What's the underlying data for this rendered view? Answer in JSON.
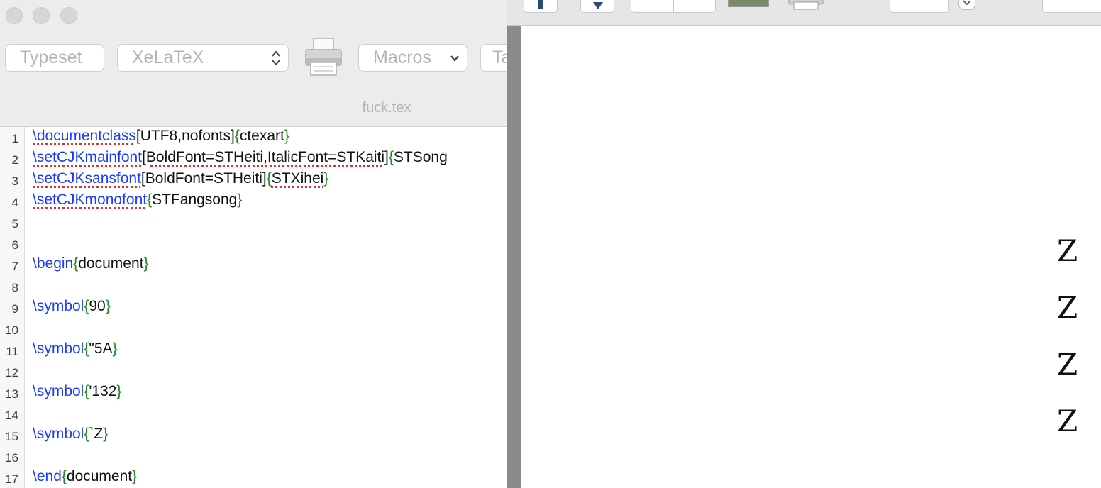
{
  "editor": {
    "toolbar": {
      "typeset_label": "Typeset",
      "engine_value": "XeLaTeX",
      "macros_label": "Macros",
      "tags_label": "Ta"
    },
    "filename": "fuck.tex",
    "line_numbers": [
      "1",
      "2",
      "3",
      "4",
      "5",
      "6",
      "7",
      "8",
      "9",
      "10",
      "11",
      "12",
      "13",
      "14",
      "15",
      "16",
      "17"
    ],
    "code": {
      "l1": {
        "cmd": "\\documentclass",
        "opt": "[UTF8,nofonts]",
        "ob": "{",
        "arg": "ctexart",
        "cb": "}"
      },
      "l2": {
        "cmd": "\\setCJKmainfont",
        "opt": "[BoldFont=STHeiti,ItalicFont=STKaiti]",
        "ob": "{",
        "arg": "STSong"
      },
      "l3": {
        "cmd": "\\setCJKsansfont",
        "opt": "[BoldFont=STHeiti]",
        "ob": "{",
        "arg": "STXihei",
        "cb": "}"
      },
      "l4": {
        "cmd": "\\setCJKmonofont",
        "ob": "{",
        "arg": "STFangsong",
        "cb": "}"
      },
      "l7": {
        "cmd": "\\begin",
        "ob": "{",
        "arg": "document",
        "cb": "}"
      },
      "l9": {
        "cmd": "\\symbol",
        "ob": "{",
        "arg": "90",
        "cb": "}"
      },
      "l11": {
        "cmd": "\\symbol",
        "ob": "{",
        "arg": "\"5A",
        "cb": "}"
      },
      "l13": {
        "cmd": "\\symbol",
        "ob": "{",
        "arg": "'132",
        "cb": "}"
      },
      "l15": {
        "cmd": "\\symbol",
        "ob": "{",
        "arg": "`Z",
        "cb": "}"
      },
      "l17": {
        "cmd": "\\end",
        "ob": "{",
        "arg": "document",
        "cb": "}"
      }
    }
  },
  "preview": {
    "output": [
      "Z",
      "Z",
      "Z",
      "Z"
    ]
  },
  "colors": {
    "command": "#1a3cff",
    "brace": "#1f8a1f",
    "spell_underline": "#e03030"
  },
  "icons": [
    "printer-icon",
    "chevron-updown-icon",
    "chevron-down-icon"
  ]
}
